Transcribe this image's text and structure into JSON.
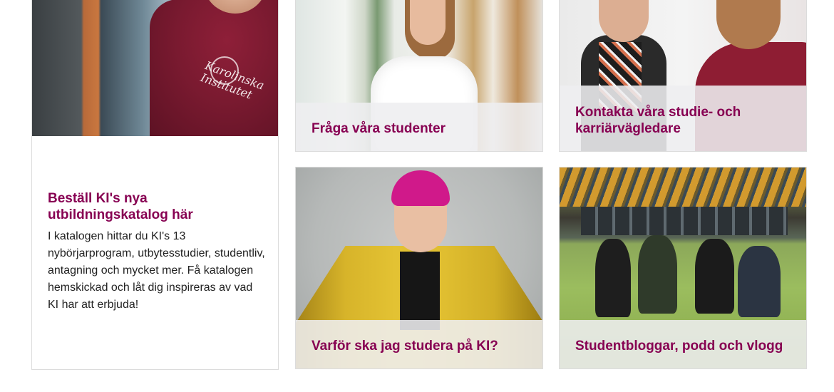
{
  "catalog_card": {
    "title": "Beställ KI's nya utbildningskatalog här",
    "description": "I katalogen hittar du KI's 13 nybörjarprogram, utbytesstudier, studentliv, antagning och mycket mer.  Få katalogen hemskickad och låt dig inspireras av vad KI har att erbjuda!",
    "image_print": "Karolinska Institutet"
  },
  "tiles": [
    {
      "label": "Fråga våra studenter"
    },
    {
      "label": "Kontakta våra studie- och karriärvägledare"
    },
    {
      "label": "Varför ska jag studera på KI?"
    },
    {
      "label": "Studentbloggar, podd och vlogg"
    }
  ],
  "colors": {
    "accent": "#870052",
    "text": "#222222",
    "caption_bg": "#eeeef0"
  }
}
